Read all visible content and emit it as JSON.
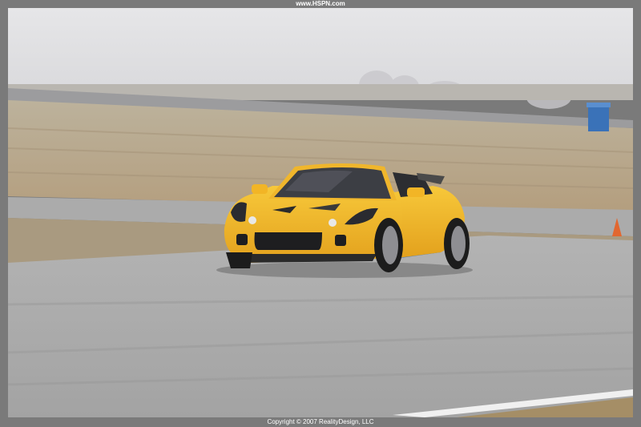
{
  "header": {
    "site": "www.HSPN.com"
  },
  "footer": {
    "copyright": "Copyright © 2007 RealityDesign, LLC"
  },
  "photo": {
    "subject": "yellow sports car on race track",
    "colors": {
      "car": "#f2b526",
      "accent": "#2f6fc9",
      "track": "#a9a9a9",
      "grass": "#b2a58c",
      "sky": "#e2e2e4"
    }
  }
}
